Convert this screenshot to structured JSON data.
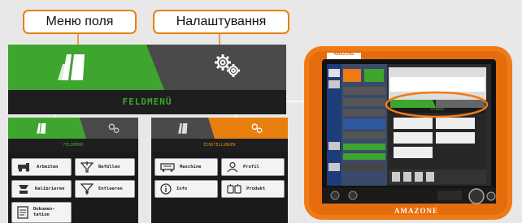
{
  "callouts": {
    "field_menu": "Меню поля",
    "settings": "Налаштування"
  },
  "main_panel": {
    "title": "FELDMENÜ",
    "tab_field_icon": "field-icon",
    "tab_settings_icon": "gears-icon"
  },
  "field_menu": {
    "title": "FELDMENÜ",
    "buttons": [
      {
        "label": "Arbeiten",
        "icon": "tractor-icon"
      },
      {
        "label": "Befüllen",
        "icon": "funnel-fill-icon"
      },
      {
        "label": "Kalibrieren",
        "icon": "scale-icon"
      },
      {
        "label": "Entleeren",
        "icon": "funnel-empty-icon"
      },
      {
        "label": "Dokumen-\ntation",
        "icon": "document-icon"
      }
    ]
  },
  "settings_menu": {
    "title": "EINSTELLUNGEN",
    "buttons": [
      {
        "label": "Maschine",
        "icon": "machine-icon"
      },
      {
        "label": "Profil",
        "icon": "user-icon"
      },
      {
        "label": "Info",
        "icon": "info-icon"
      },
      {
        "label": "Produkt",
        "icon": "product-icon"
      }
    ]
  },
  "terminal": {
    "brand_top": "AMAZONE",
    "brand_bottom": "AMAZONE",
    "screen_tabs_label": "FELDMENÜ"
  },
  "colors": {
    "accent_green": "#3ea52e",
    "accent_orange": "#e88010",
    "dark": "#1e1e1e",
    "mid_gray": "#4a4a4a"
  }
}
